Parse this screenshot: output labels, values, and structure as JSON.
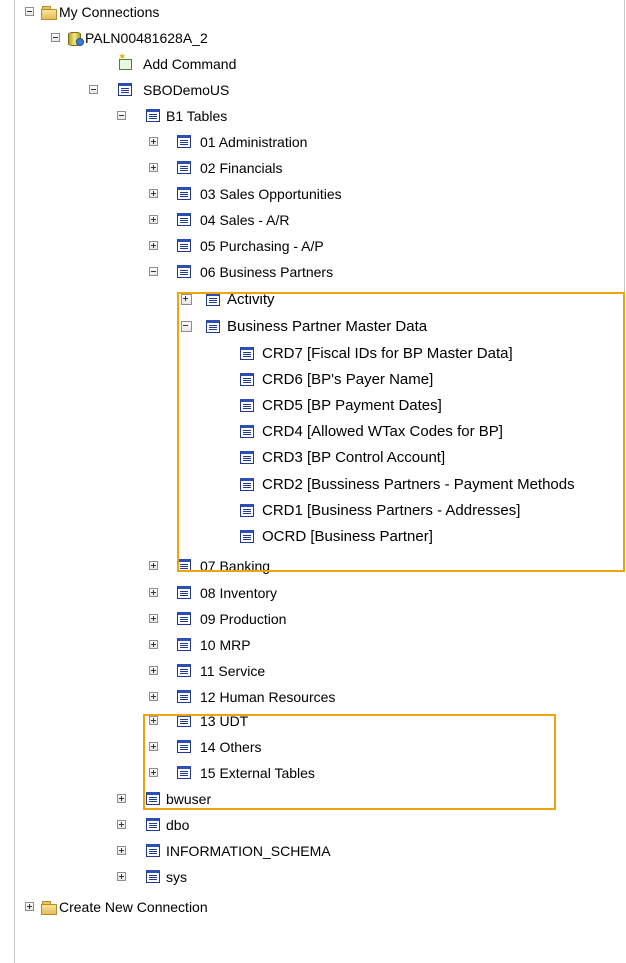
{
  "tree": [
    {
      "id": "my-connections",
      "label": "My Connections",
      "icon": "folder-icon",
      "toggle": "minus",
      "depth": 0
    },
    {
      "id": "server-paln",
      "label": "PALN00481628A_2",
      "icon": "database-server-icon",
      "toggle": "minus",
      "depth": 1
    },
    {
      "id": "add-command",
      "label": "Add Command",
      "icon": "add-command-icon",
      "toggle": "none",
      "depth": 2
    },
    {
      "id": "sbodemous",
      "label": "SBODemoUS",
      "icon": "table-icon",
      "toggle": "minus",
      "depth": 2
    },
    {
      "id": "b1-tables",
      "label": "B1 Tables",
      "icon": "table-icon",
      "toggle": "minus",
      "depth": 3
    },
    {
      "id": "01-administration",
      "label": "01 Administration",
      "icon": "table-icon",
      "toggle": "plus",
      "depth": 4
    },
    {
      "id": "02-financials",
      "label": "02 Financials",
      "icon": "table-icon",
      "toggle": "plus",
      "depth": 4
    },
    {
      "id": "03-sales-opportunities",
      "label": "03 Sales Opportunities",
      "icon": "table-icon",
      "toggle": "plus",
      "depth": 4
    },
    {
      "id": "04-sales-ar",
      "label": "04 Sales - A/R",
      "icon": "table-icon",
      "toggle": "plus",
      "depth": 4
    },
    {
      "id": "05-purchasing-ap",
      "label": "05 Purchasing - A/P",
      "icon": "table-icon",
      "toggle": "plus",
      "depth": 4
    },
    {
      "id": "06-business-partners",
      "label": "06 Business Partners",
      "icon": "table-icon",
      "toggle": "minus",
      "depth": 4
    },
    {
      "id": "activity",
      "label": "Activity",
      "icon": "table-icon",
      "toggle": "plus",
      "depth": 5,
      "zoom": true
    },
    {
      "id": "bp-master-data",
      "label": "Business Partner Master Data",
      "icon": "table-icon",
      "toggle": "minus",
      "depth": 5,
      "zoom": true
    },
    {
      "id": "crd7",
      "label": "CRD7 [Fiscal IDs for BP Master Data]",
      "icon": "table-icon",
      "toggle": "none",
      "depth": 6,
      "zoom": true
    },
    {
      "id": "crd6",
      "label": "CRD6 [BP's Payer Name]",
      "icon": "table-icon",
      "toggle": "none",
      "depth": 6,
      "zoom": true
    },
    {
      "id": "crd5",
      "label": "CRD5 [BP Payment Dates]",
      "icon": "table-icon",
      "toggle": "none",
      "depth": 6,
      "zoom": true
    },
    {
      "id": "crd4",
      "label": "CRD4 [Allowed WTax Codes for BP]",
      "icon": "table-icon",
      "toggle": "none",
      "depth": 6,
      "zoom": true
    },
    {
      "id": "crd3",
      "label": "CRD3 [BP Control Account]",
      "icon": "table-icon",
      "toggle": "none",
      "depth": 6,
      "zoom": true
    },
    {
      "id": "crd2",
      "label": "CRD2 [Bussiness Partners - Payment Methods",
      "icon": "table-icon",
      "toggle": "none",
      "depth": 6,
      "zoom": true
    },
    {
      "id": "crd1",
      "label": "CRD1 [Business Partners - Addresses]",
      "icon": "table-icon",
      "toggle": "none",
      "depth": 6,
      "zoom": true
    },
    {
      "id": "ocrd",
      "label": "OCRD [Business Partner]",
      "icon": "table-icon",
      "toggle": "none",
      "depth": 6,
      "zoom": true
    },
    {
      "id": "07-banking",
      "label": "07 Banking",
      "icon": "table-icon",
      "toggle": "plus",
      "depth": 4
    },
    {
      "id": "08-inventory",
      "label": "08 Inventory",
      "icon": "table-icon",
      "toggle": "plus",
      "depth": 4
    },
    {
      "id": "09-production",
      "label": "09 Production",
      "icon": "table-icon",
      "toggle": "plus",
      "depth": 4
    },
    {
      "id": "10-mrp",
      "label": "10 MRP",
      "icon": "table-icon",
      "toggle": "plus",
      "depth": 4
    },
    {
      "id": "11-service",
      "label": "11 Service",
      "icon": "table-icon",
      "toggle": "plus",
      "depth": 4
    },
    {
      "id": "12-human-resources",
      "label": "12 Human Resources",
      "icon": "table-icon",
      "toggle": "plus",
      "depth": 4
    },
    {
      "id": "13-udt",
      "label": "13 UDT",
      "icon": "table-icon",
      "toggle": "plus",
      "depth": 4
    },
    {
      "id": "14-others",
      "label": "14 Others",
      "icon": "table-icon",
      "toggle": "plus",
      "depth": 4
    },
    {
      "id": "15-external-tables",
      "label": "15 External Tables",
      "icon": "table-icon",
      "toggle": "plus",
      "depth": 4
    },
    {
      "id": "bwuser",
      "label": "bwuser",
      "icon": "table-icon",
      "toggle": "plus",
      "depth": 3
    },
    {
      "id": "dbo",
      "label": "dbo",
      "icon": "table-icon",
      "toggle": "plus",
      "depth": 3
    },
    {
      "id": "information-schema",
      "label": "INFORMATION_SCHEMA",
      "icon": "table-icon",
      "toggle": "plus",
      "depth": 3
    },
    {
      "id": "sys",
      "label": "sys",
      "icon": "table-icon",
      "toggle": "plus",
      "depth": 3
    },
    {
      "id": "create-new-connection",
      "label": "Create New Connection",
      "icon": "folder-icon",
      "toggle": "plus",
      "depth": 0
    }
  ],
  "highlight_color": "#f0a30a"
}
